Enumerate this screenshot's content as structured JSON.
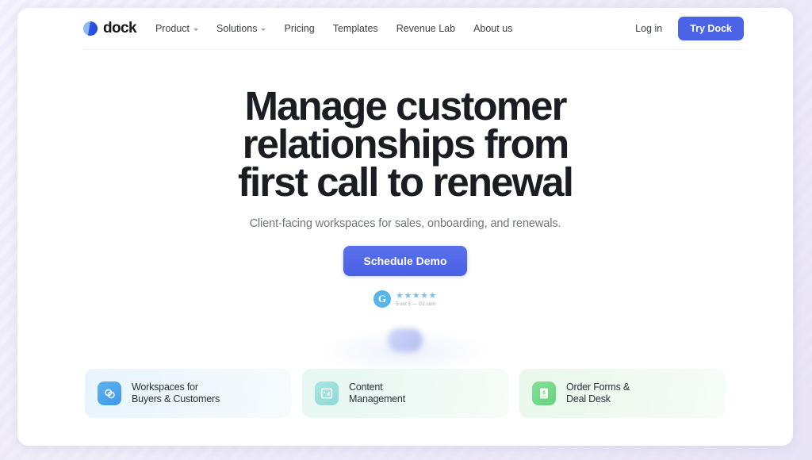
{
  "brand": {
    "name": "dock",
    "logo_icon": "dock-circle-logo",
    "accent_color": "#4a63e7"
  },
  "nav": {
    "links": [
      {
        "label": "Product",
        "has_caret": true
      },
      {
        "label": "Solutions",
        "has_caret": true
      },
      {
        "label": "Pricing",
        "has_caret": false
      },
      {
        "label": "Templates",
        "has_caret": false
      },
      {
        "label": "Revenue Lab",
        "has_caret": false
      },
      {
        "label": "About us",
        "has_caret": false
      }
    ],
    "login_label": "Log in",
    "cta_label": "Try Dock"
  },
  "hero": {
    "headline_line1": "Manage customer",
    "headline_line2": "relationships from",
    "headline_line3": "first call to renewal",
    "subheading": "Client-facing workspaces for sales, onboarding, and renewals.",
    "cta_label": "Schedule Demo",
    "rating": {
      "logo_text": "G",
      "stars": "★★★★★",
      "star_count": 5,
      "caption": "5 out 5 — G2.com"
    }
  },
  "cards": [
    {
      "line1": "Workspaces for",
      "line2": "Buyers & Customers",
      "icon": "overlapping-circles-icon",
      "icon_color": "#3f97e8"
    },
    {
      "line1": "Content",
      "line2": "Management",
      "icon": "chart-document-icon",
      "icon_color": "#8ed9d6"
    },
    {
      "line1": "Order Forms &",
      "line2": "Deal Desk",
      "icon": "dollar-invoice-icon",
      "icon_color": "#63d37d"
    }
  ]
}
